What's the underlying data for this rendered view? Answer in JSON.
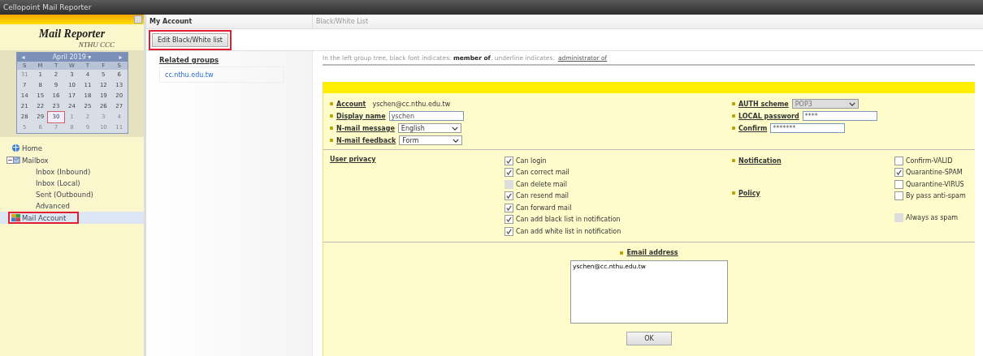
{
  "window": {
    "title": "Cellopoint Mail Reporter"
  },
  "sidebar": {
    "logo_title": "Mail Reporter",
    "logo_subtitle": "NTHU CCC",
    "calendar": {
      "month_label": "April 2019 ▾",
      "prev": "◂",
      "next": "▸",
      "weekdays": [
        "S",
        "M",
        "T",
        "W",
        "T",
        "F",
        "S"
      ],
      "weeks": [
        [
          {
            "day": "31",
            "other": true,
            "selected": false
          },
          {
            "day": "1",
            "other": false,
            "selected": false
          },
          {
            "day": "2",
            "other": false,
            "selected": false
          },
          {
            "day": "3",
            "other": false,
            "selected": false
          },
          {
            "day": "4",
            "other": false,
            "selected": false
          },
          {
            "day": "5",
            "other": false,
            "selected": false
          },
          {
            "day": "6",
            "other": false,
            "selected": false
          }
        ],
        [
          {
            "day": "7",
            "other": false,
            "selected": false
          },
          {
            "day": "8",
            "other": false,
            "selected": false
          },
          {
            "day": "9",
            "other": false,
            "selected": false
          },
          {
            "day": "10",
            "other": false,
            "selected": false
          },
          {
            "day": "11",
            "other": false,
            "selected": false
          },
          {
            "day": "12",
            "other": false,
            "selected": false
          },
          {
            "day": "13",
            "other": false,
            "selected": false
          }
        ],
        [
          {
            "day": "14",
            "other": false,
            "selected": false
          },
          {
            "day": "15",
            "other": false,
            "selected": false
          },
          {
            "day": "16",
            "other": false,
            "selected": false
          },
          {
            "day": "17",
            "other": false,
            "selected": false
          },
          {
            "day": "18",
            "other": false,
            "selected": false
          },
          {
            "day": "19",
            "other": false,
            "selected": false
          },
          {
            "day": "20",
            "other": false,
            "selected": false
          }
        ],
        [
          {
            "day": "21",
            "other": false,
            "selected": false
          },
          {
            "day": "22",
            "other": false,
            "selected": false
          },
          {
            "day": "23",
            "other": false,
            "selected": false
          },
          {
            "day": "24",
            "other": false,
            "selected": false
          },
          {
            "day": "25",
            "other": false,
            "selected": false
          },
          {
            "day": "26",
            "other": false,
            "selected": false
          },
          {
            "day": "27",
            "other": false,
            "selected": false
          }
        ],
        [
          {
            "day": "28",
            "other": false,
            "selected": false
          },
          {
            "day": "29",
            "other": false,
            "selected": false
          },
          {
            "day": "30",
            "other": false,
            "selected": true
          },
          {
            "day": "1",
            "other": true,
            "selected": false
          },
          {
            "day": "2",
            "other": true,
            "selected": false
          },
          {
            "day": "3",
            "other": true,
            "selected": false
          },
          {
            "day": "4",
            "other": true,
            "selected": false
          }
        ],
        [
          {
            "day": "5",
            "other": true,
            "selected": false
          },
          {
            "day": "6",
            "other": true,
            "selected": false
          },
          {
            "day": "7",
            "other": true,
            "selected": false
          },
          {
            "day": "8",
            "other": true,
            "selected": false
          },
          {
            "day": "9",
            "other": true,
            "selected": false
          },
          {
            "day": "10",
            "other": true,
            "selected": false
          },
          {
            "day": "11",
            "other": true,
            "selected": false
          }
        ]
      ]
    },
    "tree": [
      {
        "label": "Home",
        "kind": "home",
        "selected": false
      },
      {
        "label": "Mailbox",
        "kind": "mailbox",
        "selected": false,
        "expanded": true,
        "children": [
          {
            "label": "Inbox (Inbound)",
            "selected": false
          },
          {
            "label": "Inbox (Local)",
            "selected": false
          },
          {
            "label": "Sent (Outbound)",
            "selected": false
          },
          {
            "label": "Advanced",
            "selected": false
          }
        ]
      },
      {
        "label": "Mail Account",
        "kind": "account",
        "selected": true,
        "highlighted": true
      }
    ]
  },
  "tabs": [
    {
      "label": "My Account",
      "selected": true
    },
    {
      "label": "Black/White List",
      "selected": false
    }
  ],
  "toolbar": {
    "button": "Edit Black/White list",
    "highlighted": true
  },
  "related_groups": {
    "title": "Related groups",
    "items": [
      "cc.nthu.edu.tw"
    ]
  },
  "legend": {
    "text": "In the left group tree, black font indicates: **member of**, underline indicates:",
    "admin_label": "administrator of"
  },
  "form": {
    "left_fields": [
      {
        "label": "Account",
        "kind": "text",
        "value": "yschen@cc.nthu.edu.tw"
      },
      {
        "label": "Display name",
        "kind": "input",
        "value": "yschen"
      },
      {
        "label": "N-mail message",
        "kind": "select",
        "value": "English",
        "disabled": false
      },
      {
        "label": "N-mail feedback",
        "kind": "select",
        "value": "Form",
        "disabled": false
      }
    ],
    "right_fields": [
      {
        "label": "AUTH scheme",
        "kind": "select",
        "value": "POP3",
        "disabled": true
      },
      {
        "label": "LOCAL password",
        "kind": "input",
        "value": "****"
      },
      {
        "label": "Confirm",
        "kind": "input",
        "value": "*******"
      }
    ],
    "privacy": {
      "label": "User privacy",
      "options": [
        {
          "label": "Can login",
          "checked": true,
          "disabled": false
        },
        {
          "label": "Can correct mail",
          "checked": true,
          "disabled": false
        },
        {
          "label": "Can delete mail",
          "checked": false,
          "disabled": true
        },
        {
          "label": "Can resend mail",
          "checked": true,
          "disabled": false
        },
        {
          "label": "Can forward mail",
          "checked": true,
          "disabled": false
        },
        {
          "label": "Can add black list in notification",
          "checked": true,
          "disabled": false
        },
        {
          "label": "Can add white list in notification",
          "checked": true,
          "disabled": false
        }
      ]
    },
    "notification": {
      "label": "Notification",
      "options": [
        {
          "label": "Confirm-VALID",
          "checked": false,
          "disabled": false
        },
        {
          "label": "Quarantine-SPAM",
          "checked": true,
          "disabled": false
        },
        {
          "label": "Quarantine-VIRUS",
          "checked": false,
          "disabled": false
        }
      ]
    },
    "policy": {
      "label": "Policy",
      "options": [
        {
          "label": "By pass anti-spam",
          "checked": false,
          "disabled": false
        },
        {
          "label": "Always as spam",
          "checked": false,
          "disabled": true
        }
      ]
    },
    "email": {
      "label": "Email address",
      "value": "yschen@cc.nthu.edu.tw"
    },
    "ok_button": "OK"
  }
}
